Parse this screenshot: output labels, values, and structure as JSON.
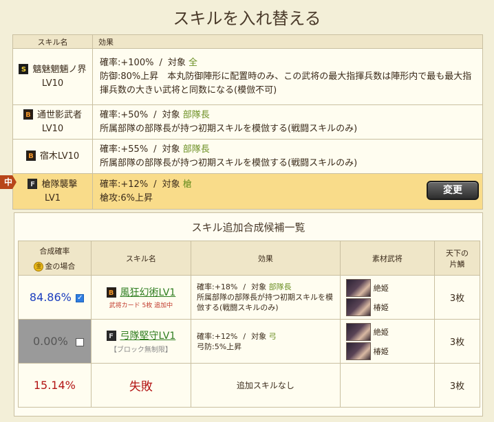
{
  "page_title": "スキルを入れ替える",
  "skills_table": {
    "headers": {
      "name": "スキル名",
      "effect": "効果"
    },
    "rows": [
      {
        "rank": "S",
        "name": "魑魅魍魎ノ界LV10",
        "rate": "確率:+100%",
        "target_label": "対象",
        "target": "全",
        "desc": "防御:80%上昇　本丸防御陣形に配置時のみ、この武将の最大指揮兵数は陣形内で最も最大指揮兵数の大きい武将と同数になる(模倣不可)"
      },
      {
        "rank": "B",
        "name_line1": "通世影武者",
        "name_line2": "LV10",
        "rate": "確率:+50%",
        "target_label": "対象",
        "target": "部隊長",
        "desc": "所属部隊の部隊長が持つ初期スキルを模倣する(戦闘スキルのみ)"
      },
      {
        "rank": "B",
        "name": "宿木LV10",
        "rate": "確率:+55%",
        "target_label": "対象",
        "target": "部隊長",
        "desc": "所属部隊の部隊長が持つ初期スキルを模倣する(戦闘スキルのみ)"
      },
      {
        "rank": "F",
        "name_line1": "槍隊襲撃",
        "name_line2": "LV1",
        "rate": "確率:+12%",
        "target_label": "対象",
        "target": "槍",
        "desc": "槍攻:6%上昇",
        "selected": true
      }
    ],
    "selected_tag": "中",
    "change_button": "変更"
  },
  "candidates": {
    "title": "スキル追加合成候補一覧",
    "headers": {
      "rate": "合成確率",
      "gold": "金の場合",
      "name": "スキル名",
      "effect": "効果",
      "material": "素材武将",
      "piece_line1": "天下の",
      "piece_line2": "片鱗"
    },
    "rows": [
      {
        "rate": "84.86%",
        "checked": true,
        "rank": "B",
        "name": "風狂幻術LV1",
        "note": "武将カード 5枚 追加中",
        "eff_rate": "確率:+18%",
        "target_label": "対象",
        "target": "部隊長",
        "desc": "所属部隊の部隊長が持つ初期スキルを模倣する(戦闘スキルのみ)",
        "materials": [
          "絶姫",
          "椿姫"
        ],
        "pieces": "3枚"
      },
      {
        "rate": "0.00%",
        "checked": false,
        "rank": "F",
        "name": "弓隊堅守LV1",
        "note": "【ブロック無制限】",
        "eff_rate": "確率:+12%",
        "target_label": "対象",
        "target": "弓",
        "desc": "弓防:5%上昇",
        "materials": [
          "絶姫",
          "椿姫"
        ],
        "pieces": "3枚"
      },
      {
        "rate": "15.14%",
        "result": "失敗",
        "desc": "追加スキルなし",
        "pieces": "3枚"
      }
    ]
  },
  "colors": {
    "accent_green": "#6b8f23",
    "rate_blue": "#1a3dbe",
    "fail_red": "#b31414"
  }
}
